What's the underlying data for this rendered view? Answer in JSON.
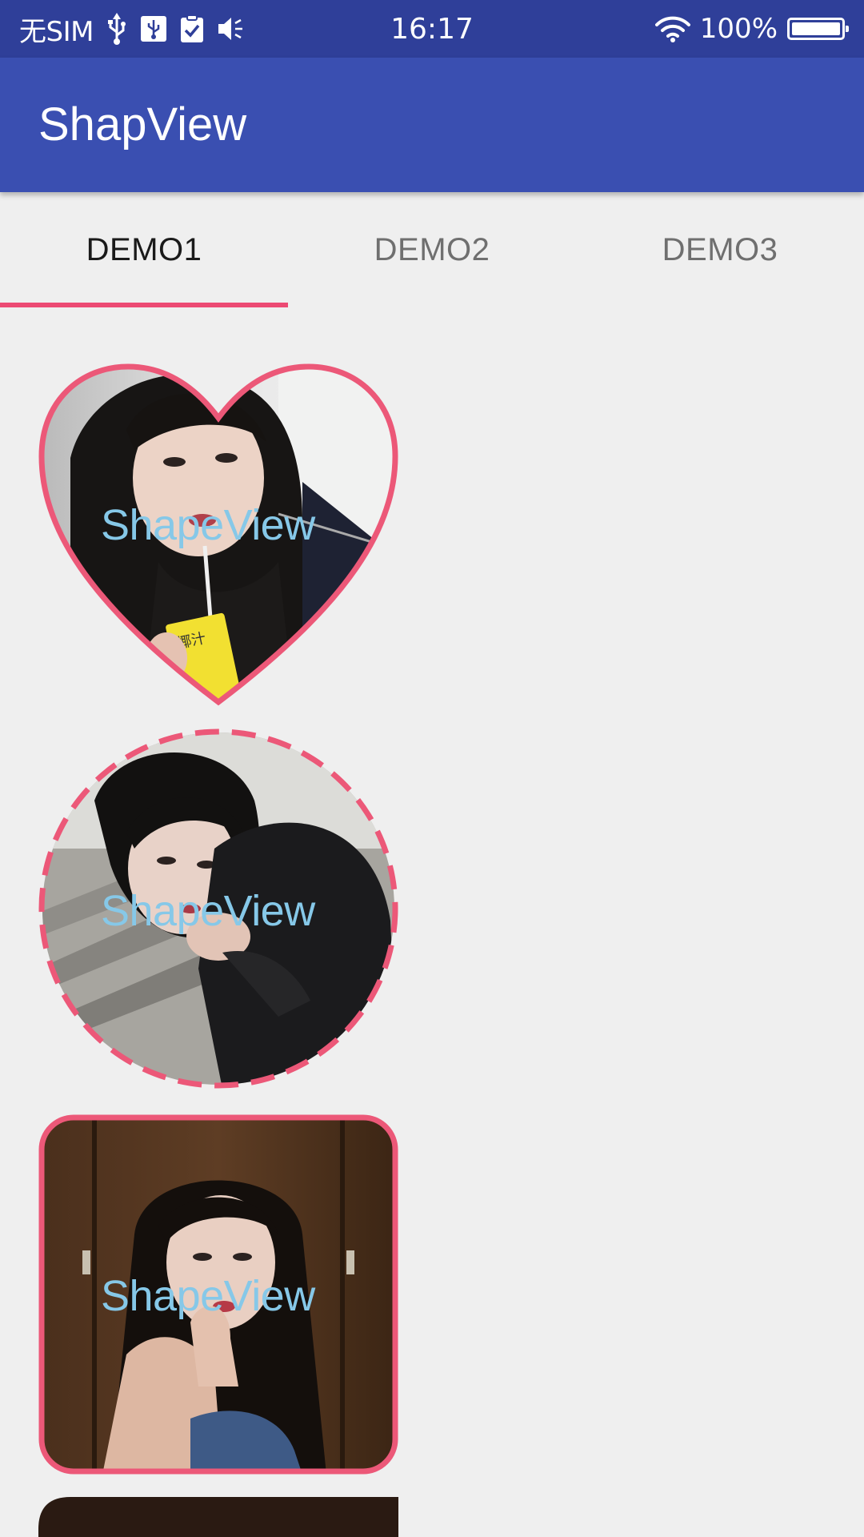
{
  "status_bar": {
    "carrier": "无SIM",
    "time": "16:17",
    "battery_percent": "100%",
    "battery_level": 1.0,
    "icons": [
      "usb-icon",
      "usb-debug-icon",
      "clipboard-check-icon",
      "volume-icon",
      "wifi-icon",
      "battery-icon"
    ]
  },
  "app_bar": {
    "title": "ShapView"
  },
  "tabs": [
    {
      "label": "DEMO1",
      "active": true
    },
    {
      "label": "DEMO2",
      "active": false
    },
    {
      "label": "DEMO3",
      "active": false
    }
  ],
  "shapes": [
    {
      "shape": "heart",
      "label": "ShapeView",
      "border": "solid",
      "image": "photo of girl holding yellow juice box"
    },
    {
      "shape": "circle",
      "label": "ShapeView",
      "border": "dashed",
      "image": "photo of girl in black sweater"
    },
    {
      "shape": "rounded-rect",
      "label": "ShapeView",
      "border": "solid",
      "image": "photo of girl with long dark hair"
    }
  ],
  "colors": {
    "status_bar": "#2f3f99",
    "app_bar": "#3a4fb1",
    "accent": "#ec4a73",
    "label": "#86c8e8",
    "background": "#efefef"
  }
}
